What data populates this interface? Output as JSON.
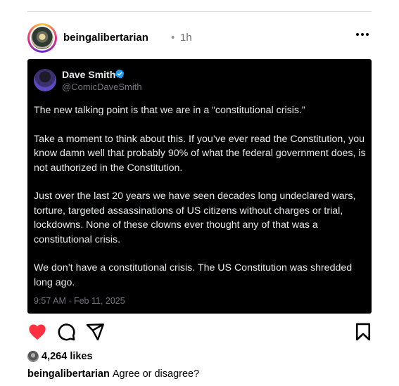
{
  "post": {
    "username": "beingalibertarian",
    "separator": "•",
    "time_ago": "1h"
  },
  "tweet": {
    "name": "Dave Smith",
    "handle": "@ComicDaveSmith",
    "paragraphs": [
      "The new talking point is that we are in a “constitutional crisis.”",
      "Take a moment to think about this. If you’ve ever read the Constitution, you know damn well that probably 90% of what the federal government does, is not authorized in the Constitution.",
      "Just over the last 20 years we have seen decades long undeclared wars, torture, targeted assassinations of US citizens without charges or trial, lockdowns. None of these clowns ever thought any of that was a constitutional crisis.",
      "We don’t have a constitutional crisis. The US Constitution was shredded long ago."
    ],
    "timestamp": "9:57 AM · Feb 11, 2025"
  },
  "engagement": {
    "likes_label": "4,264 likes"
  },
  "caption": {
    "username": "beingalibertarian",
    "text": "Agree or disagree?"
  },
  "icons": {
    "like": "heart-icon",
    "comment": "comment-icon",
    "share": "share-icon",
    "save": "bookmark-icon",
    "more": "more-icon",
    "verified": "verified-badge-icon"
  },
  "colors": {
    "like_red": "#ff3040",
    "verified_blue": "#1d9bf0",
    "tweet_bg": "#000000"
  }
}
